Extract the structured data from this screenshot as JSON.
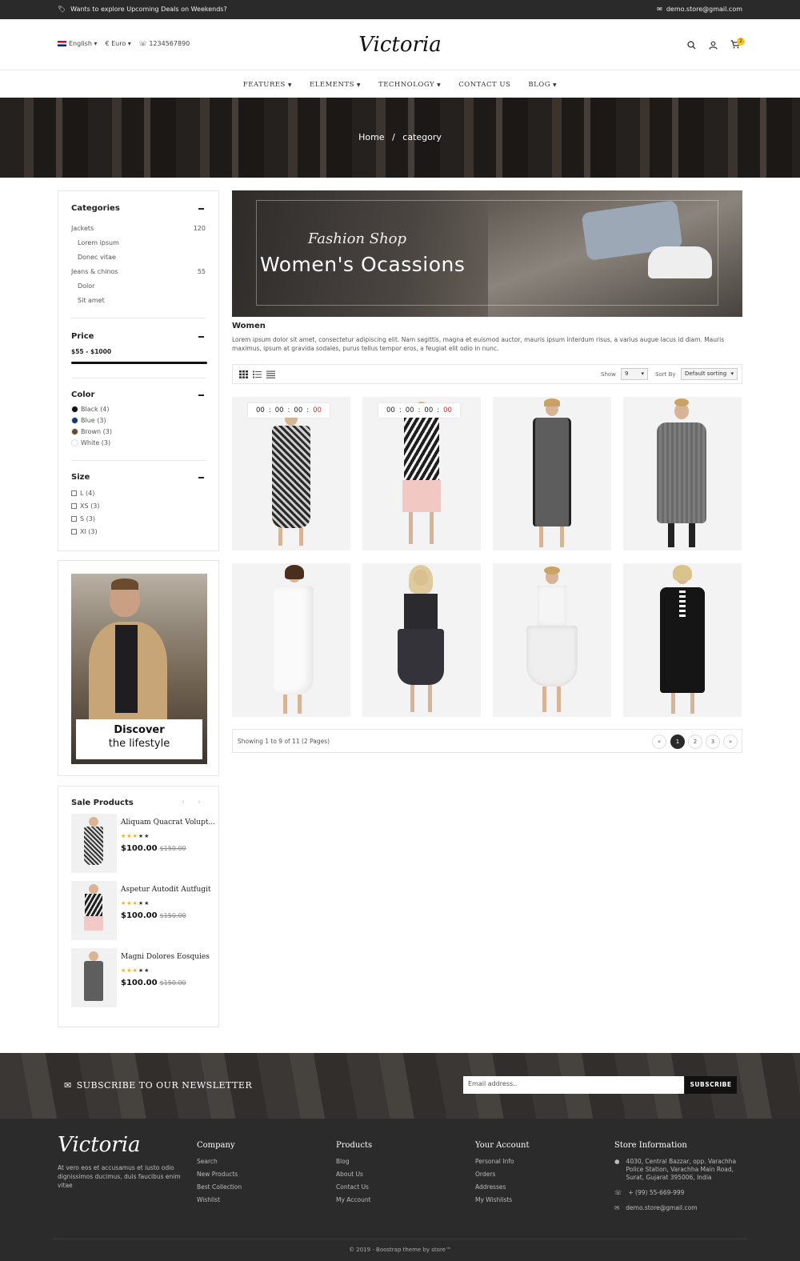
{
  "topbar": {
    "promo": "Wants to explore Upcoming Deals on Weekends?",
    "email": "demo.store@gmail.com"
  },
  "header": {
    "language": "English",
    "currency": "€ Euro",
    "phone": "1234567890",
    "logo": "Victoria",
    "cart_count": "2"
  },
  "nav": [
    "FEATURES",
    "ELEMENTS",
    "TECHNOLOGY",
    "CONTACT US",
    "BLOG"
  ],
  "breadcrumb": {
    "home": "Home",
    "sep": "/",
    "current": "category"
  },
  "sidebar": {
    "categories_title": "Categories",
    "categories": [
      {
        "label": "Jackets",
        "count": "120"
      },
      {
        "label": "Lorem ipsum",
        "count": ""
      },
      {
        "label": "Donec vitae",
        "count": ""
      },
      {
        "label": "Jeans & chinos",
        "count": "55"
      },
      {
        "label": "Dolor",
        "count": ""
      },
      {
        "label": "Sit amet",
        "count": ""
      }
    ],
    "price_title": "Price",
    "price_range": "$55 - $1000",
    "color_title": "Color",
    "colors": [
      {
        "label": "Black (4)",
        "hex": "#111111"
      },
      {
        "label": "Blue (3)",
        "hex": "#123a73"
      },
      {
        "label": "Brown (3)",
        "hex": "#6b4a2b"
      },
      {
        "label": "White (3)",
        "hex": "#ffffff"
      }
    ],
    "size_title": "Size",
    "sizes": [
      "L (4)",
      "XS (3)",
      "S (3)",
      "Xl (3)"
    ],
    "promo_line1": "Discover",
    "promo_line2": "the lifestyle",
    "sale_title": "Sale Products",
    "sale_products": [
      {
        "name": "Aliquam Quacrat Volupt...",
        "price": "$100.00",
        "old_price": "$150.00",
        "rating": 3
      },
      {
        "name": "Aspetur Autodit Autfugit",
        "price": "$100.00",
        "old_price": "$150.00",
        "rating": 3
      },
      {
        "name": "Magni Dolores Eosquies",
        "price": "$100.00",
        "old_price": "$150.00",
        "rating": 3
      }
    ]
  },
  "banner": {
    "script": "Fashion Shop",
    "title": "Women's  Ocassions"
  },
  "category": {
    "title": "Women",
    "description": "Lorem ipsum dolor sit amet, consectetur adipiscing elit. Nam sagittis, magna et euismod auctor, mauris ipsum interdum risus, a varius augue lacus id diam. Mauris maximus, ipsum at gravida sodales, purus tellus tempor eros, a feugiat elit odio in nunc."
  },
  "toolbar": {
    "show_label": "Show",
    "show_value": "9",
    "sort_label": "Sort By",
    "sort_value": "Default sorting"
  },
  "timer": {
    "d": "00",
    "h": "00",
    "m": "00",
    "s": "00"
  },
  "pagination": {
    "summary": "Showing 1 to 9 of 11 (2 Pages)",
    "prev": "«",
    "pages": [
      "1",
      "2",
      "3"
    ],
    "next": "»"
  },
  "newsletter": {
    "title": "SUBSCRIBE TO OUR NEWSLETTER",
    "placeholder": "Email address..",
    "button": "SUBSCRIBE"
  },
  "footer": {
    "logo": "Victoria",
    "about": "At vero eos et accusamus et iusto odio dignissimos ducimus, duis faucibus enim vitae",
    "company_title": "Company",
    "company": [
      "Search",
      "New Products",
      "Best Collection",
      "Wishlist"
    ],
    "products_title": "Products",
    "products": [
      "Blog",
      "About Us",
      "Contact Us",
      "My Account"
    ],
    "account_title": "Your Account",
    "account": [
      "Personal Info",
      "Orders",
      "Addresses",
      "My Wishlists"
    ],
    "store_title": "Store Information",
    "address": "4030, Central Bazzar, opp. Varachha Police Station, Varachha Main Road, Surat, Gujarat 395006, India",
    "phone": "+ (99) 55-669-999",
    "email": "demo.store@gmail.com",
    "copyright": "© 2019 - Boostrap theme by store™"
  }
}
